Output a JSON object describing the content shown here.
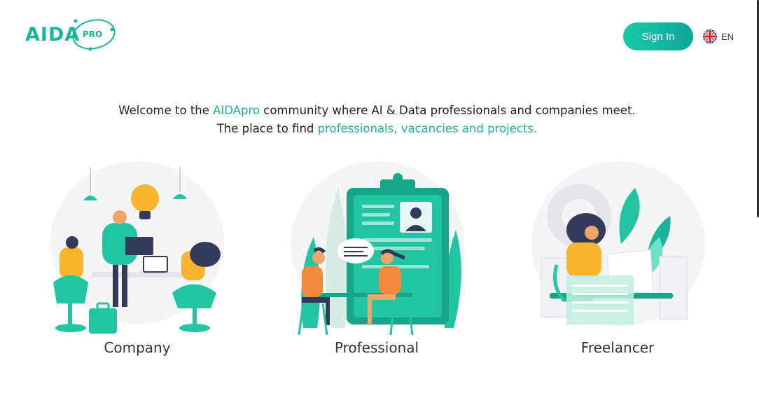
{
  "header": {
    "logo_text": "AIDA",
    "logo_suffix": "PRO",
    "signin_label": "Sign In",
    "language": "EN",
    "language_flag": "uk-flag-icon"
  },
  "intro": {
    "line1_prefix": "Welcome to the ",
    "line1_brand": "AIDApro",
    "line1_suffix": " community where AI & Data professionals and companies meet.",
    "line2_prefix": "The place to find ",
    "line2_link": "professionals, vacancies and projects."
  },
  "cards": [
    {
      "label": "Company",
      "illustration": "team-meeting-illustration"
    },
    {
      "label": "Professional",
      "illustration": "job-interview-clipboard-illustration"
    },
    {
      "label": "Freelancer",
      "illustration": "freelancer-laptop-illustration"
    }
  ],
  "colors": {
    "accent": "#1bb39a",
    "button_gradient_start": "#18c9a7",
    "button_gradient_end": "#0fa79a",
    "text": "#222222"
  }
}
